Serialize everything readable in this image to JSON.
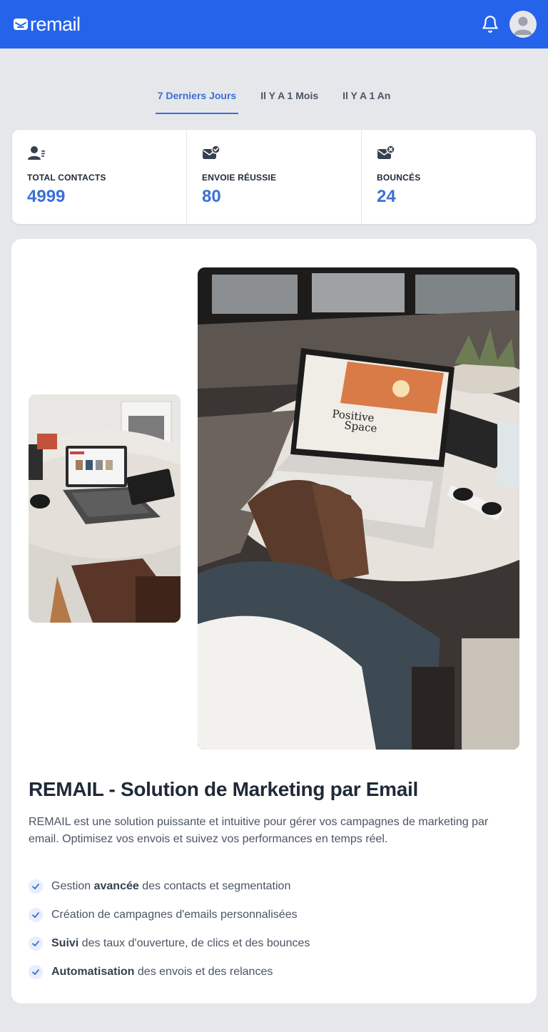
{
  "app": {
    "logo_text": "remail"
  },
  "header": {
    "bell_icon": "bell-icon",
    "avatar_icon": "user-avatar-icon"
  },
  "tabs": [
    {
      "label": "7 Derniers Jours",
      "active": true
    },
    {
      "label": "Il Y A 1 Mois",
      "active": false
    },
    {
      "label": "Il Y A 1 An",
      "active": false
    }
  ],
  "stats": [
    {
      "icon": "contacts-icon",
      "label": "TOTAL CONTACTS",
      "value": "4999"
    },
    {
      "icon": "mail-check-icon",
      "label": "ENVOIE RÉUSSIE",
      "value": "80"
    },
    {
      "icon": "mail-x-icon",
      "label": "BOUNCÉS",
      "value": "24"
    }
  ],
  "promo": {
    "title": "REMAIL - Solution de Marketing par Email",
    "description": "REMAIL est une solution puissante et intuitive pour gérer vos campagnes de marketing par email. Optimisez vos envois et suivez vos performances en temps réel.",
    "features": [
      {
        "before": "Gestion ",
        "bold": "avancée",
        "after": " des contacts et segmentation"
      },
      {
        "before": "Création de campagnes d'emails personnalisées",
        "bold": "",
        "after": ""
      },
      {
        "before": "",
        "bold": "Suivi",
        "after": " des taux d'ouverture, de clics et des bounces"
      },
      {
        "before": "",
        "bold": "Automatisation",
        "after": " des envois et des relances"
      }
    ],
    "large_image_text_1": "Positive",
    "large_image_text_2": "Space"
  },
  "colors": {
    "primary": "#2563eb",
    "accent": "#3b6fd6",
    "background": "#e5e7eb"
  }
}
